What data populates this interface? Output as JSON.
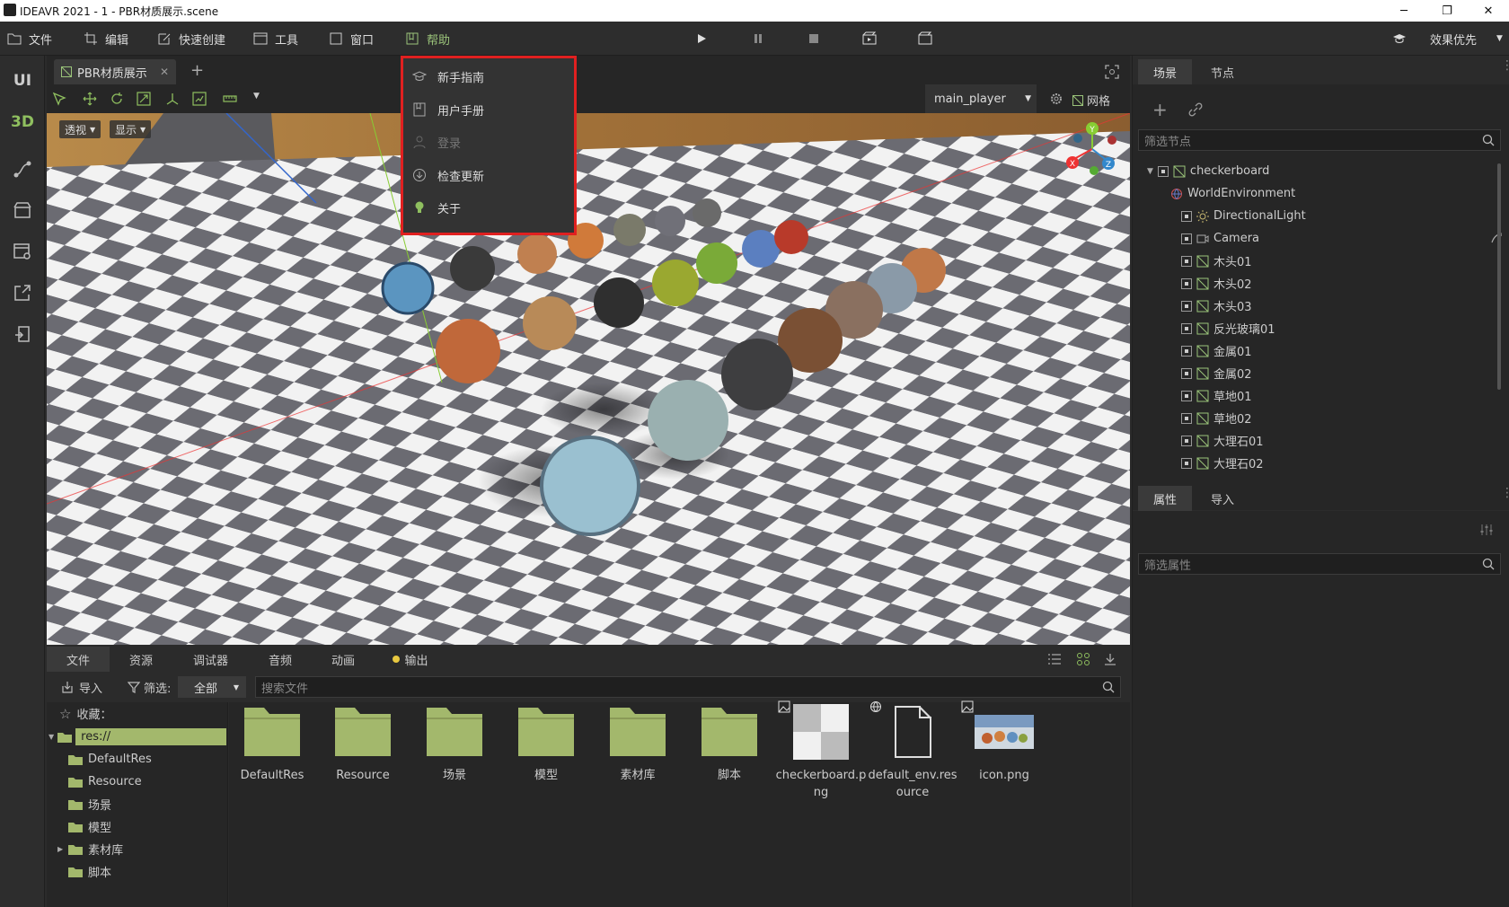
{
  "window": {
    "title": "IDEAVR 2021 - 1 - PBR材质展示.scene",
    "min": "─",
    "max": "❐",
    "close": "✕"
  },
  "menubar": {
    "items": [
      "文件",
      "编辑",
      "快速创建",
      "工具",
      "窗口",
      "帮助"
    ],
    "right_label": "效果优先"
  },
  "leftbar": {
    "ui": "UI",
    "d3": "3D"
  },
  "doc_tab": {
    "label": "PBR材质展示",
    "close": "✕",
    "add": "+"
  },
  "viewport_toolbar": {
    "player_select": "main_player",
    "grid_label": "网格"
  },
  "viewport": {
    "perspective": "透视",
    "display": "显示",
    "axis": {
      "x": "X",
      "y": "Y",
      "z": "Z"
    }
  },
  "help_menu": {
    "items": [
      {
        "label": "新手指南",
        "icon": "graduation-cap-icon",
        "disabled": false
      },
      {
        "label": "用户手册",
        "icon": "book-icon",
        "disabled": false
      },
      {
        "label": "登录",
        "icon": "user-icon",
        "disabled": true
      },
      {
        "label": "检查更新",
        "icon": "download-circle-icon",
        "disabled": false
      },
      {
        "label": "关于",
        "icon": "lightbulb-icon",
        "disabled": false
      }
    ]
  },
  "scene_panel": {
    "tabs": [
      "场景",
      "节点"
    ],
    "filter_placeholder": "筛选节点",
    "nodes": [
      "checkerboard",
      "WorldEnvironment",
      "DirectionalLight",
      "Camera",
      "木头01",
      "木头02",
      "木头03",
      "反光玻璃01",
      "金属01",
      "金属02",
      "草地01",
      "草地02",
      "大理石01",
      "大理石02"
    ]
  },
  "props_panel": {
    "tabs": [
      "属性",
      "导入"
    ],
    "filter_placeholder": "筛选属性"
  },
  "bottom": {
    "tabs": [
      "文件",
      "资源",
      "调试器",
      "音频",
      "动画",
      "输出"
    ],
    "import_label": "导入",
    "filter_label": "筛选:",
    "filter_value": "全部",
    "search_placeholder": "搜索文件",
    "favorites": "收藏：",
    "tree": [
      "res://",
      "DefaultRes",
      "Resource",
      "场景",
      "模型",
      "素材库",
      "脚本"
    ],
    "files": [
      {
        "name": "DefaultRes",
        "kind": "folder"
      },
      {
        "name": "Resource",
        "kind": "folder"
      },
      {
        "name": "场景",
        "kind": "folder"
      },
      {
        "name": "模型",
        "kind": "folder"
      },
      {
        "name": "素材库",
        "kind": "folder"
      },
      {
        "name": "脚本",
        "kind": "folder"
      },
      {
        "name": "checkerboard.p\nng",
        "kind": "image"
      },
      {
        "name": "default_env.res\nource",
        "kind": "resource"
      },
      {
        "name": "icon.png",
        "kind": "image"
      }
    ]
  },
  "colors": {
    "accent": "#9bc47a",
    "highlight_red": "#e02020",
    "folder": "#a3b86c"
  }
}
